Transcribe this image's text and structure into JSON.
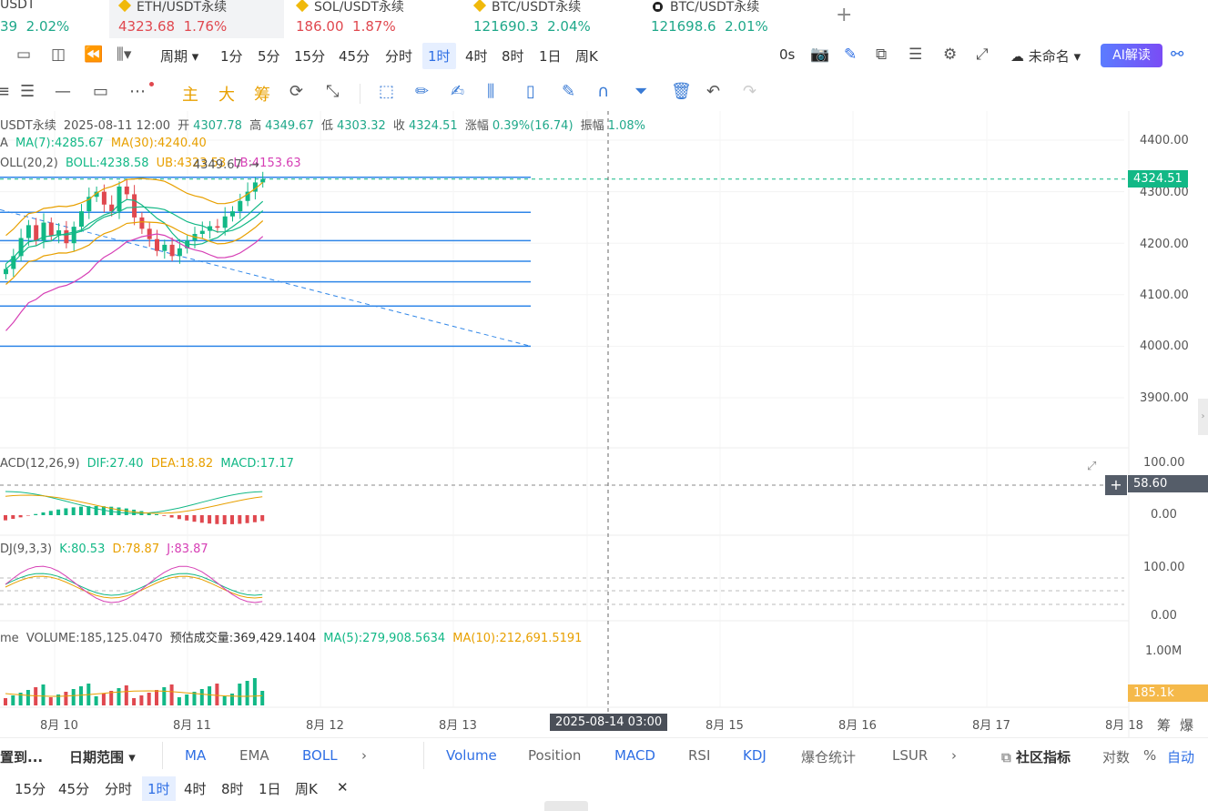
{
  "tickers": [
    {
      "symbol": "USDT",
      "price": "39",
      "change": "2.02%",
      "dir": "up",
      "active": false,
      "icon": "none"
    },
    {
      "symbol": "ETH/USDT永续",
      "price": "4323.68",
      "change": "1.76%",
      "dir": "down",
      "active": true,
      "icon": "binance-icon"
    },
    {
      "symbol": "SOL/USDT永续",
      "price": "186.00",
      "change": "1.87%",
      "dir": "down",
      "active": false,
      "icon": "binance-icon"
    },
    {
      "symbol": "BTC/USDT永续",
      "price": "121690.3",
      "change": "2.04%",
      "dir": "up",
      "active": false,
      "icon": "binance-icon"
    },
    {
      "symbol": "BTC/USDT永续",
      "price": "121698.6",
      "change": "2.01%",
      "dir": "up",
      "active": false,
      "icon": "okx-icon"
    }
  ],
  "add_tab_label": "+",
  "toolbar": {
    "period_label": "周期",
    "periods": [
      "1分",
      "5分",
      "15分",
      "45分",
      "分时",
      "1时",
      "4时",
      "8时",
      "1日",
      "周K"
    ],
    "selected_period": "1时",
    "countdown": "0s",
    "layout_name": "未命名",
    "ai_label": "AI解读"
  },
  "drawing_toolbar": {
    "main_label": "主",
    "big_label": "大",
    "chip_label": "筹"
  },
  "legend": {
    "ohlc": {
      "symbol": "USDT永续",
      "date": "2025-08-11 12:00",
      "open_label": "开",
      "open": "4307.78",
      "high_label": "高",
      "high": "4349.67",
      "low_label": "低",
      "low": "4303.32",
      "close_label": "收",
      "close": "4324.51",
      "change_label": "涨幅",
      "change": "0.39%(16.74)",
      "amp_label": "振幅",
      "amp": "1.08%"
    },
    "ma": {
      "prefix": "A",
      "ma7": "MA(7):4285.67",
      "ma30": "MA(30):4240.40"
    },
    "boll": {
      "prefix": "OLL(20,2)",
      "boll": "BOLL:4238.58",
      "ub": "UB:4323.53",
      "lb": "LB:4153.63"
    },
    "high_marker": "4349.67",
    "macd": {
      "prefix": "ACD(12,26,9)",
      "dif": "DIF:27.40",
      "dea": "DEA:18.82",
      "macd": "MACD:17.17"
    },
    "kdj": {
      "prefix": "DJ(9,3,3)",
      "k": "K:80.53",
      "d": "D:78.87",
      "j": "J:83.87"
    },
    "volume": {
      "prefix": "me",
      "vol": "VOLUME:185,125.0470",
      "est": "预估成交量:369,429.1404",
      "ma5": "MA(5):279,908.5634",
      "ma10": "MA(10):212,691.5191"
    }
  },
  "price_axis": [
    "4400.00",
    "4300.00",
    "4200.00",
    "4100.00",
    "4000.00",
    "3900.00"
  ],
  "macd_axis": [
    "100.00",
    "0.00"
  ],
  "kdj_axis": [
    "100.00",
    "0.00"
  ],
  "vol_axis": [
    "1.00M"
  ],
  "current_price": "4324.51",
  "crosshair_value": "58.60",
  "volume_tag": "185.1k",
  "date_axis": [
    "8月 10",
    "8月 11",
    "8月 12",
    "8月 13",
    "8月 15",
    "8月 16",
    "8月 17",
    "8月 18"
  ],
  "crosshair_date": "2025-08-14 03:00",
  "date_axis_right": [
    "筹",
    "爆"
  ],
  "chart_data": {
    "type": "candlestick",
    "ohlc_close_series": [
      4150,
      4175,
      4210,
      4235,
      4205,
      4240,
      4215,
      4225,
      4200,
      4232,
      4262,
      4290,
      4300,
      4275,
      4262,
      4310,
      4295,
      4250,
      4228,
      4208,
      4185,
      4197,
      4175,
      4190,
      4205,
      4218,
      4224,
      4233,
      4230,
      4252,
      4262,
      4282,
      4300,
      4318,
      4324.51
    ],
    "horizontal_lines": [
      4324.51,
      4260,
      4205,
      4165,
      4125,
      4078,
      4000
    ],
    "ylim": [
      3800,
      4420
    ]
  },
  "indicator_tabs_left": [
    "日期范围",
    "MA",
    "EMA",
    "BOLL"
  ],
  "indicator_tabs_left_prefix": "置到...",
  "indicator_tabs_right": [
    "Volume",
    "Position",
    "MACD",
    "RSI",
    "KDJ",
    "爆仓统计",
    "LSUR"
  ],
  "indicator_tabs_far": [
    "社区指标",
    "对数",
    "%",
    "自动"
  ],
  "bottom_periods": [
    "15分",
    "45分",
    "分时",
    "1时",
    "4时",
    "8时",
    "1日",
    "周K"
  ],
  "bottom_selected": "1时"
}
